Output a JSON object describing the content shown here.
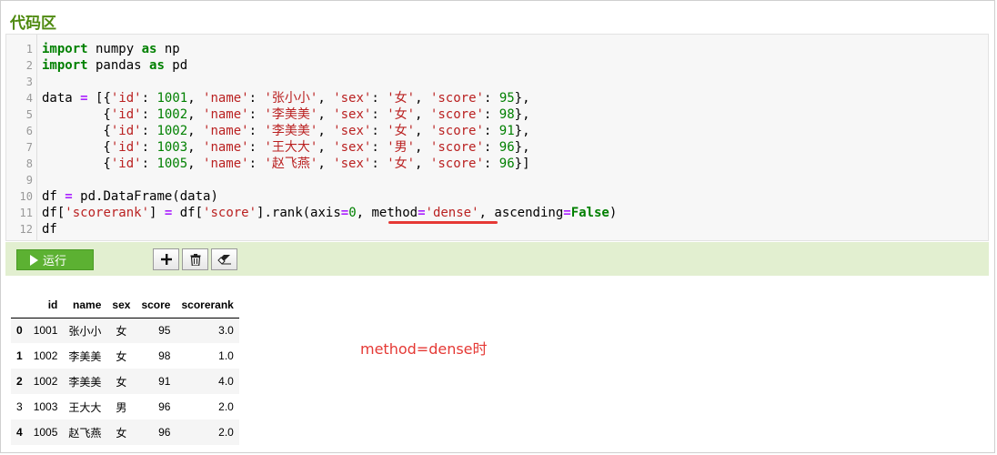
{
  "section_title": "代码区",
  "editor": {
    "line_numbers": [
      "1",
      "2",
      "3",
      "4",
      "5",
      "6",
      "7",
      "8",
      "9",
      "10",
      "11",
      "12"
    ],
    "lines": [
      [
        {
          "t": "kw",
          "v": "import"
        },
        {
          "t": "",
          "v": " numpy "
        },
        {
          "t": "kw",
          "v": "as"
        },
        {
          "t": "",
          "v": " np"
        }
      ],
      [
        {
          "t": "kw",
          "v": "import"
        },
        {
          "t": "",
          "v": " pandas "
        },
        {
          "t": "kw",
          "v": "as"
        },
        {
          "t": "",
          "v": " pd"
        }
      ],
      [],
      [
        {
          "t": "",
          "v": "data "
        },
        {
          "t": "op",
          "v": "="
        },
        {
          "t": "",
          "v": " [{"
        },
        {
          "t": "str",
          "v": "'id'"
        },
        {
          "t": "",
          "v": ": "
        },
        {
          "t": "num",
          "v": "1001"
        },
        {
          "t": "",
          "v": ", "
        },
        {
          "t": "str",
          "v": "'name'"
        },
        {
          "t": "",
          "v": ": "
        },
        {
          "t": "str",
          "v": "'张小小'"
        },
        {
          "t": "",
          "v": ", "
        },
        {
          "t": "str",
          "v": "'sex'"
        },
        {
          "t": "",
          "v": ": "
        },
        {
          "t": "str",
          "v": "'女'"
        },
        {
          "t": "",
          "v": ", "
        },
        {
          "t": "str",
          "v": "'score'"
        },
        {
          "t": "",
          "v": ": "
        },
        {
          "t": "num",
          "v": "95"
        },
        {
          "t": "",
          "v": "},"
        }
      ],
      [
        {
          "t": "",
          "v": "        {"
        },
        {
          "t": "str",
          "v": "'id'"
        },
        {
          "t": "",
          "v": ": "
        },
        {
          "t": "num",
          "v": "1002"
        },
        {
          "t": "",
          "v": ", "
        },
        {
          "t": "str",
          "v": "'name'"
        },
        {
          "t": "",
          "v": ": "
        },
        {
          "t": "str",
          "v": "'李美美'"
        },
        {
          "t": "",
          "v": ", "
        },
        {
          "t": "str",
          "v": "'sex'"
        },
        {
          "t": "",
          "v": ": "
        },
        {
          "t": "str",
          "v": "'女'"
        },
        {
          "t": "",
          "v": ", "
        },
        {
          "t": "str",
          "v": "'score'"
        },
        {
          "t": "",
          "v": ": "
        },
        {
          "t": "num",
          "v": "98"
        },
        {
          "t": "",
          "v": "},"
        }
      ],
      [
        {
          "t": "",
          "v": "        {"
        },
        {
          "t": "str",
          "v": "'id'"
        },
        {
          "t": "",
          "v": ": "
        },
        {
          "t": "num",
          "v": "1002"
        },
        {
          "t": "",
          "v": ", "
        },
        {
          "t": "str",
          "v": "'name'"
        },
        {
          "t": "",
          "v": ": "
        },
        {
          "t": "str",
          "v": "'李美美'"
        },
        {
          "t": "",
          "v": ", "
        },
        {
          "t": "str",
          "v": "'sex'"
        },
        {
          "t": "",
          "v": ": "
        },
        {
          "t": "str",
          "v": "'女'"
        },
        {
          "t": "",
          "v": ", "
        },
        {
          "t": "str",
          "v": "'score'"
        },
        {
          "t": "",
          "v": ": "
        },
        {
          "t": "num",
          "v": "91"
        },
        {
          "t": "",
          "v": "},"
        }
      ],
      [
        {
          "t": "",
          "v": "        {"
        },
        {
          "t": "str",
          "v": "'id'"
        },
        {
          "t": "",
          "v": ": "
        },
        {
          "t": "num",
          "v": "1003"
        },
        {
          "t": "",
          "v": ", "
        },
        {
          "t": "str",
          "v": "'name'"
        },
        {
          "t": "",
          "v": ": "
        },
        {
          "t": "str",
          "v": "'王大大'"
        },
        {
          "t": "",
          "v": ", "
        },
        {
          "t": "str",
          "v": "'sex'"
        },
        {
          "t": "",
          "v": ": "
        },
        {
          "t": "str",
          "v": "'男'"
        },
        {
          "t": "",
          "v": ", "
        },
        {
          "t": "str",
          "v": "'score'"
        },
        {
          "t": "",
          "v": ": "
        },
        {
          "t": "num",
          "v": "96"
        },
        {
          "t": "",
          "v": "},"
        }
      ],
      [
        {
          "t": "",
          "v": "        {"
        },
        {
          "t": "str",
          "v": "'id'"
        },
        {
          "t": "",
          "v": ": "
        },
        {
          "t": "num",
          "v": "1005"
        },
        {
          "t": "",
          "v": ", "
        },
        {
          "t": "str",
          "v": "'name'"
        },
        {
          "t": "",
          "v": ": "
        },
        {
          "t": "str",
          "v": "'赵飞燕'"
        },
        {
          "t": "",
          "v": ", "
        },
        {
          "t": "str",
          "v": "'sex'"
        },
        {
          "t": "",
          "v": ": "
        },
        {
          "t": "str",
          "v": "'女'"
        },
        {
          "t": "",
          "v": ", "
        },
        {
          "t": "str",
          "v": "'score'"
        },
        {
          "t": "",
          "v": ": "
        },
        {
          "t": "num",
          "v": "96"
        },
        {
          "t": "",
          "v": "}]"
        }
      ],
      [],
      [
        {
          "t": "",
          "v": "df "
        },
        {
          "t": "op",
          "v": "="
        },
        {
          "t": "",
          "v": " pd.DataFrame(data)"
        }
      ],
      [
        {
          "t": "",
          "v": "df["
        },
        {
          "t": "str",
          "v": "'scorerank'"
        },
        {
          "t": "",
          "v": "] "
        },
        {
          "t": "op",
          "v": "="
        },
        {
          "t": "",
          "v": " df["
        },
        {
          "t": "str",
          "v": "'score'"
        },
        {
          "t": "",
          "v": "].rank(axis"
        },
        {
          "t": "op",
          "v": "="
        },
        {
          "t": "num",
          "v": "0"
        },
        {
          "t": "",
          "v": ", method"
        },
        {
          "t": "op",
          "v": "="
        },
        {
          "t": "str",
          "v": "'dense'"
        },
        {
          "t": "",
          "v": ", ascending"
        },
        {
          "t": "op",
          "v": "="
        },
        {
          "t": "kw",
          "v": "False"
        },
        {
          "t": "",
          "v": ")"
        }
      ],
      [
        {
          "t": "",
          "v": "df"
        }
      ]
    ]
  },
  "toolbar": {
    "run_label": "运行",
    "add_icon": "plus-icon",
    "delete_icon": "trash-icon",
    "clear_icon": "eraser-icon"
  },
  "table": {
    "columns": [
      "id",
      "name",
      "sex",
      "score",
      "scorerank"
    ],
    "rows": [
      {
        "index": "0",
        "cells": [
          "1001",
          "张小小",
          "女",
          "95",
          "3.0"
        ]
      },
      {
        "index": "1",
        "cells": [
          "1002",
          "李美美",
          "女",
          "98",
          "1.0"
        ]
      },
      {
        "index": "2",
        "cells": [
          "1002",
          "李美美",
          "女",
          "91",
          "4.0"
        ]
      },
      {
        "index": "3",
        "cells": [
          "1003",
          "王大大",
          "男",
          "96",
          "2.0"
        ]
      },
      {
        "index": "4",
        "cells": [
          "1005",
          "赵飞燕",
          "女",
          "96",
          "2.0"
        ]
      }
    ]
  },
  "annotation": {
    "note": "method=dense时"
  },
  "colors": {
    "accent_green": "#4f8a10",
    "run_green": "#5cb132",
    "toolbar_bg": "#e2efd0",
    "annotation_red": "#e53935"
  }
}
